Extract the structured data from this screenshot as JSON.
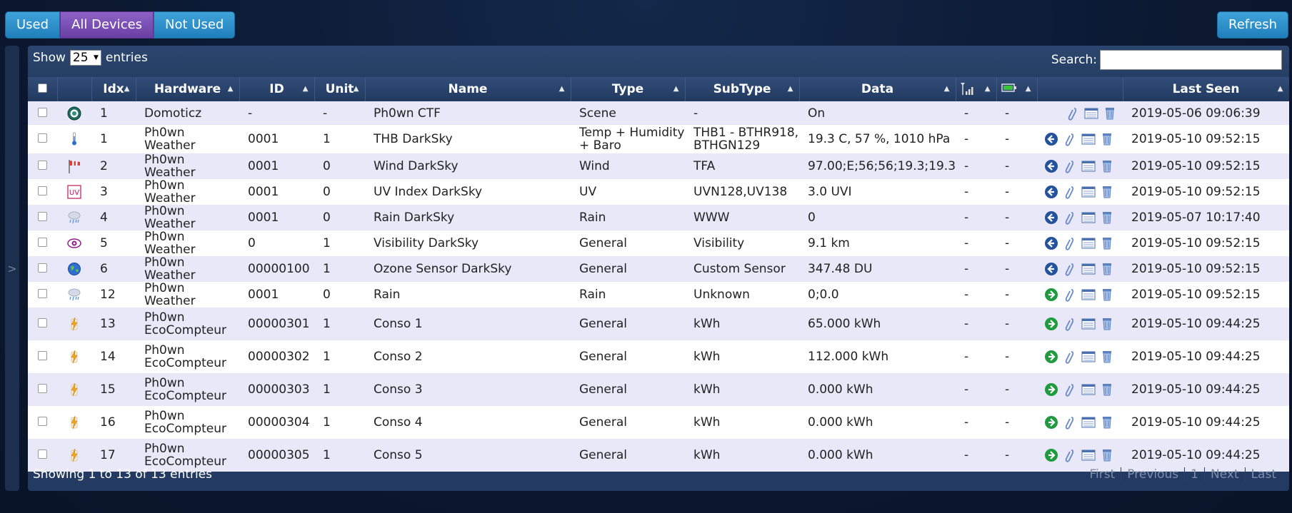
{
  "filters": {
    "used": "Used",
    "all": "All Devices",
    "not_used": "Not Used"
  },
  "refresh": "Refresh",
  "side_toggle": ">",
  "length": {
    "show": "Show",
    "value": "25",
    "entries": "entries"
  },
  "search": {
    "label": "Search:",
    "value": ""
  },
  "columns": {
    "idx": "Idx",
    "hardware": "Hardware",
    "id": "ID",
    "unit": "Unit",
    "name": "Name",
    "type": "Type",
    "subtype": "SubType",
    "data": "Data",
    "last_seen": "Last Seen"
  },
  "rows": [
    {
      "icon": "scene",
      "idx": "1",
      "hardware": "Domoticz",
      "id": "-",
      "unit": "-",
      "name": "Ph0wn CTF",
      "type": "Scene",
      "subtype": "-",
      "data": "On",
      "signal": "-",
      "battery": "-",
      "action": "none",
      "last_seen": "2019-05-06 09:06:39"
    },
    {
      "icon": "temp",
      "idx": "1",
      "hardware": "Ph0wn Weather",
      "id": "0001",
      "unit": "1",
      "name": "THB DarkSky",
      "type": "Temp + Humidity + Baro",
      "subtype": "THB1 - BTHR918, BTHGN129",
      "data": "19.3 C, 57 %, 1010 hPa",
      "signal": "-",
      "battery": "-",
      "action": "remove",
      "last_seen": "2019-05-10 09:52:15"
    },
    {
      "icon": "wind",
      "idx": "2",
      "hardware": "Ph0wn Weather",
      "id": "0001",
      "unit": "0",
      "name": "Wind DarkSky",
      "type": "Wind",
      "subtype": "TFA",
      "data": "97.00;E;56;56;19.3;19.3",
      "signal": "-",
      "battery": "-",
      "action": "remove",
      "last_seen": "2019-05-10 09:52:15"
    },
    {
      "icon": "uv",
      "idx": "3",
      "hardware": "Ph0wn Weather",
      "id": "0001",
      "unit": "0",
      "name": "UV Index DarkSky",
      "type": "UV",
      "subtype": "UVN128,UV138",
      "data": "3.0 UVI",
      "signal": "-",
      "battery": "-",
      "action": "remove",
      "last_seen": "2019-05-10 09:52:15"
    },
    {
      "icon": "rain",
      "idx": "4",
      "hardware": "Ph0wn Weather",
      "id": "0001",
      "unit": "0",
      "name": "Rain DarkSky",
      "type": "Rain",
      "subtype": "WWW",
      "data": "0",
      "signal": "-",
      "battery": "-",
      "action": "remove",
      "last_seen": "2019-05-07 10:17:40"
    },
    {
      "icon": "eye",
      "idx": "5",
      "hardware": "Ph0wn Weather",
      "id": "0",
      "unit": "1",
      "name": "Visibility DarkSky",
      "type": "General",
      "subtype": "Visibility",
      "data": "9.1 km",
      "signal": "-",
      "battery": "-",
      "action": "remove",
      "last_seen": "2019-05-10 09:52:15"
    },
    {
      "icon": "globe",
      "idx": "6",
      "hardware": "Ph0wn Weather",
      "id": "00000100",
      "unit": "1",
      "name": "Ozone Sensor DarkSky",
      "type": "General",
      "subtype": "Custom Sensor",
      "data": "347.48 DU",
      "signal": "-",
      "battery": "-",
      "action": "remove",
      "last_seen": "2019-05-10 09:52:15"
    },
    {
      "icon": "rain",
      "idx": "12",
      "hardware": "Ph0wn Weather",
      "id": "0001",
      "unit": "0",
      "name": "Rain",
      "type": "Rain",
      "subtype": "Unknown",
      "data": "0;0.0",
      "signal": "-",
      "battery": "-",
      "action": "add",
      "last_seen": "2019-05-10 09:52:15"
    },
    {
      "icon": "bolt",
      "idx": "13",
      "hardware": "Ph0wn EcoCompteur",
      "id": "00000301",
      "unit": "1",
      "name": "Conso 1",
      "type": "General",
      "subtype": "kWh",
      "data": "65.000 kWh",
      "signal": "-",
      "battery": "-",
      "action": "add",
      "last_seen": "2019-05-10 09:44:25"
    },
    {
      "icon": "bolt",
      "idx": "14",
      "hardware": "Ph0wn EcoCompteur",
      "id": "00000302",
      "unit": "1",
      "name": "Conso 2",
      "type": "General",
      "subtype": "kWh",
      "data": "112.000 kWh",
      "signal": "-",
      "battery": "-",
      "action": "add",
      "last_seen": "2019-05-10 09:44:25"
    },
    {
      "icon": "bolt",
      "idx": "15",
      "hardware": "Ph0wn EcoCompteur",
      "id": "00000303",
      "unit": "1",
      "name": "Conso 3",
      "type": "General",
      "subtype": "kWh",
      "data": "0.000 kWh",
      "signal": "-",
      "battery": "-",
      "action": "add",
      "last_seen": "2019-05-10 09:44:25"
    },
    {
      "icon": "bolt",
      "idx": "16",
      "hardware": "Ph0wn EcoCompteur",
      "id": "00000304",
      "unit": "1",
      "name": "Conso 4",
      "type": "General",
      "subtype": "kWh",
      "data": "0.000 kWh",
      "signal": "-",
      "battery": "-",
      "action": "add",
      "last_seen": "2019-05-10 09:44:25"
    },
    {
      "icon": "bolt",
      "idx": "17",
      "hardware": "Ph0wn EcoCompteur",
      "id": "00000305",
      "unit": "1",
      "name": "Conso 5",
      "type": "General",
      "subtype": "kWh",
      "data": "0.000 kWh",
      "signal": "-",
      "battery": "-",
      "action": "add",
      "last_seen": "2019-05-10 09:44:25"
    }
  ],
  "footer": {
    "info": "Showing 1 to 13 of 13 entries",
    "first": "First",
    "previous": "Previous",
    "page": "1",
    "next": "Next",
    "last": "Last"
  }
}
